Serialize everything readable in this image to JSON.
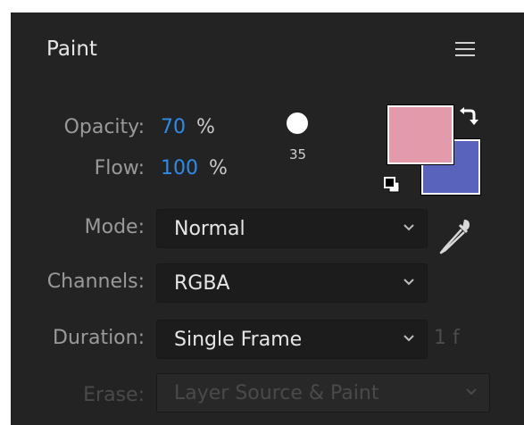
{
  "panel": {
    "title": "Paint",
    "menu_icon": "hamburger-menu-icon"
  },
  "opacity": {
    "label": "Opacity:",
    "value": "70",
    "unit": "%"
  },
  "flow": {
    "label": "Flow:",
    "value": "100",
    "unit": "%"
  },
  "brush": {
    "size": "35"
  },
  "colors": {
    "foreground": "#e39aaa",
    "background": "#5a63bb",
    "accent_value": "#2d8ceb",
    "swap_icon": "swap-colors-icon",
    "default_icon": "default-colors-icon"
  },
  "mode": {
    "label": "Mode:",
    "selected": "Normal"
  },
  "channels": {
    "label": "Channels:",
    "selected": "RGBA"
  },
  "duration": {
    "label": "Duration:",
    "selected": "Single Frame",
    "frames": "1 f"
  },
  "erase": {
    "label": "Erase:",
    "selected": "Layer Source & Paint"
  }
}
